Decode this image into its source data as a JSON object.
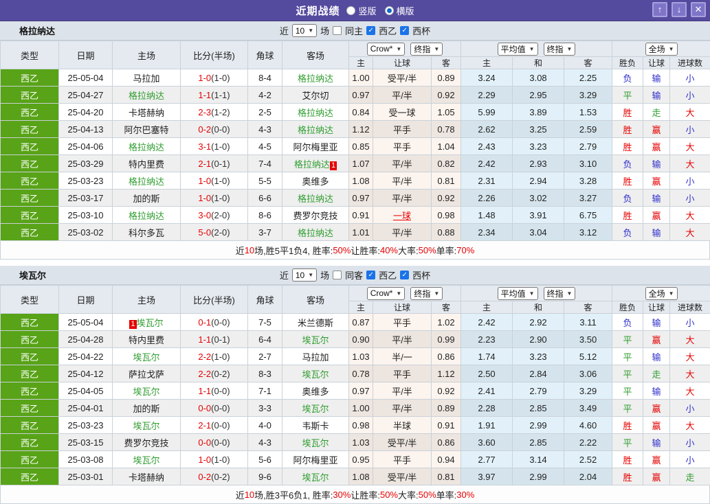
{
  "titlebar": {
    "title": "近期战绩",
    "radios": [
      {
        "label": "竖版",
        "selected": false
      },
      {
        "label": "横版",
        "selected": true
      }
    ],
    "buttons": {
      "up": "↑",
      "down": "↓",
      "close": "✕"
    }
  },
  "controls": {
    "near_label": "近",
    "count": "10",
    "games_label": "场",
    "league1": "西乙",
    "league2": "西杯",
    "odds_source": "Crow*",
    "final_odds": "终指",
    "average": "平均值",
    "scope": "全场"
  },
  "header": {
    "type": "类型",
    "date": "日期",
    "home": "主场",
    "score": "比分(半场)",
    "corner": "角球",
    "away": "客场",
    "sub": {
      "home": "主",
      "handicap": "让球",
      "away": "客",
      "avg_home": "主",
      "avg_draw": "和",
      "avg_away": "客",
      "wdl": "胜负",
      "hcp_result": "让球",
      "goals": "进球数"
    }
  },
  "colors": {
    "accent_purple": "#544a9e",
    "type_green": "#58a317",
    "self_team_green": "#2f9d2f",
    "win_red": "#e60000",
    "lose_blue": "#3030cc",
    "draw_green": "#2f9d2f"
  },
  "sections": [
    {
      "team": "格拉纳达",
      "filter": {
        "same_label": "同主",
        "same_checked": false,
        "league1_checked": true,
        "league2_checked": true
      },
      "rows": [
        {
          "league": "西乙",
          "date": "25-05-04",
          "home": {
            "name": "马拉加",
            "self": false
          },
          "score": "1-0",
          "half": "(1-0)",
          "corner": "8-4",
          "away": {
            "name": "格拉纳达",
            "self": true
          },
          "odds": [
            "1.00",
            "受平/半",
            "0.89"
          ],
          "avg": [
            "3.24",
            "3.08",
            "2.25"
          ],
          "results": [
            "负",
            "输",
            "小"
          ]
        },
        {
          "league": "西乙",
          "date": "25-04-27",
          "home": {
            "name": "格拉纳达",
            "self": true
          },
          "score": "1-1",
          "half": "(1-1)",
          "corner": "4-2",
          "away": {
            "name": "艾尔切",
            "self": false
          },
          "odds": [
            "0.97",
            "平/半",
            "0.92"
          ],
          "avg": [
            "2.29",
            "2.95",
            "3.29"
          ],
          "results": [
            "平",
            "输",
            "小"
          ]
        },
        {
          "league": "西乙",
          "date": "25-04-20",
          "home": {
            "name": "卡塔赫纳",
            "self": false
          },
          "score": "2-3",
          "half": "(1-2)",
          "corner": "2-5",
          "away": {
            "name": "格拉纳达",
            "self": true
          },
          "odds": [
            "0.84",
            "受一球",
            "1.05"
          ],
          "avg": [
            "5.99",
            "3.89",
            "1.53"
          ],
          "results": [
            "胜",
            "走",
            "大"
          ]
        },
        {
          "league": "西乙",
          "date": "25-04-13",
          "home": {
            "name": "阿尔巴塞特",
            "self": false
          },
          "score": "0-2",
          "half": "(0-0)",
          "corner": "4-3",
          "away": {
            "name": "格拉纳达",
            "self": true
          },
          "odds": [
            "1.12",
            "平手",
            "0.78"
          ],
          "avg": [
            "2.62",
            "3.25",
            "2.59"
          ],
          "results": [
            "胜",
            "赢",
            "小"
          ]
        },
        {
          "league": "西乙",
          "date": "25-04-06",
          "home": {
            "name": "格拉纳达",
            "self": true
          },
          "score": "3-1",
          "half": "(1-0)",
          "corner": "4-5",
          "away": {
            "name": "阿尔梅里亚",
            "self": false
          },
          "odds": [
            "0.85",
            "平手",
            "1.04"
          ],
          "avg": [
            "2.43",
            "3.23",
            "2.79"
          ],
          "results": [
            "胜",
            "赢",
            "大"
          ]
        },
        {
          "league": "西乙",
          "date": "25-03-29",
          "home": {
            "name": "特内里费",
            "self": false
          },
          "score": "2-1",
          "half": "(0-1)",
          "corner": "7-4",
          "away": {
            "name": "格拉纳达",
            "self": true,
            "badge": "1",
            "badge_pos": "after"
          },
          "odds": [
            "1.07",
            "平/半",
            "0.82"
          ],
          "avg": [
            "2.42",
            "2.93",
            "3.10"
          ],
          "results": [
            "负",
            "输",
            "大"
          ]
        },
        {
          "league": "西乙",
          "date": "25-03-23",
          "home": {
            "name": "格拉纳达",
            "self": true
          },
          "score": "1-0",
          "half": "(1-0)",
          "corner": "5-5",
          "away": {
            "name": "奥维多",
            "self": false
          },
          "odds": [
            "1.08",
            "平/半",
            "0.81"
          ],
          "avg": [
            "2.31",
            "2.94",
            "3.28"
          ],
          "results": [
            "胜",
            "赢",
            "小"
          ]
        },
        {
          "league": "西乙",
          "date": "25-03-17",
          "home": {
            "name": "加的斯",
            "self": false
          },
          "score": "1-0",
          "half": "(1-0)",
          "corner": "6-6",
          "away": {
            "name": "格拉纳达",
            "self": true
          },
          "odds": [
            "0.97",
            "平/半",
            "0.92"
          ],
          "avg": [
            "2.26",
            "3.02",
            "3.27"
          ],
          "results": [
            "负",
            "输",
            "小"
          ]
        },
        {
          "league": "西乙",
          "date": "25-03-10",
          "home": {
            "name": "格拉纳达",
            "self": true
          },
          "score": "3-0",
          "half": "(2-0)",
          "corner": "8-6",
          "away": {
            "name": "费罗尔竞技",
            "self": false
          },
          "odds": [
            "0.91",
            "一球",
            "0.98"
          ],
          "hcp_red": true,
          "avg": [
            "1.48",
            "3.91",
            "6.75"
          ],
          "results": [
            "胜",
            "赢",
            "大"
          ]
        },
        {
          "league": "西乙",
          "date": "25-03-02",
          "home": {
            "name": "科尔多瓦",
            "self": false
          },
          "score": "5-0",
          "half": "(2-0)",
          "corner": "3-7",
          "away": {
            "name": "格拉纳达",
            "self": true
          },
          "odds": [
            "1.01",
            "平/半",
            "0.88"
          ],
          "avg": [
            "2.34",
            "3.04",
            "3.12"
          ],
          "results": [
            "负",
            "输",
            "大"
          ]
        }
      ],
      "summary_parts": [
        {
          "t": "近"
        },
        {
          "t": "10",
          "red": true
        },
        {
          "t": "场,胜5平1负4, 胜率:"
        },
        {
          "t": "50%",
          "red": true
        },
        {
          "t": " 让胜率:"
        },
        {
          "t": "40%",
          "red": true
        },
        {
          "t": " 大率:"
        },
        {
          "t": "50%",
          "red": true
        },
        {
          "t": " 单率:"
        },
        {
          "t": "70%",
          "red": true
        }
      ]
    },
    {
      "team": "埃瓦尔",
      "filter": {
        "same_label": "同客",
        "same_checked": false,
        "league1_checked": true,
        "league2_checked": true
      },
      "rows": [
        {
          "league": "西乙",
          "date": "25-05-04",
          "home": {
            "name": "埃瓦尔",
            "self": true,
            "badge": "1",
            "badge_pos": "before"
          },
          "score": "0-1",
          "half": "(0-0)",
          "corner": "7-5",
          "away": {
            "name": "米兰德斯",
            "self": false
          },
          "odds": [
            "0.87",
            "平手",
            "1.02"
          ],
          "avg": [
            "2.42",
            "2.92",
            "3.11"
          ],
          "results": [
            "负",
            "输",
            "小"
          ]
        },
        {
          "league": "西乙",
          "date": "25-04-28",
          "home": {
            "name": "特内里费",
            "self": false
          },
          "score": "1-1",
          "half": "(0-1)",
          "corner": "6-4",
          "away": {
            "name": "埃瓦尔",
            "self": true
          },
          "odds": [
            "0.90",
            "平/半",
            "0.99"
          ],
          "avg": [
            "2.23",
            "2.90",
            "3.50"
          ],
          "results": [
            "平",
            "赢",
            "大"
          ]
        },
        {
          "league": "西乙",
          "date": "25-04-22",
          "home": {
            "name": "埃瓦尔",
            "self": true
          },
          "score": "2-2",
          "half": "(1-0)",
          "corner": "2-7",
          "away": {
            "name": "马拉加",
            "self": false
          },
          "odds": [
            "1.03",
            "半/一",
            "0.86"
          ],
          "avg": [
            "1.74",
            "3.23",
            "5.12"
          ],
          "results": [
            "平",
            "输",
            "大"
          ]
        },
        {
          "league": "西乙",
          "date": "25-04-12",
          "home": {
            "name": "萨拉戈萨",
            "self": false
          },
          "score": "2-2",
          "half": "(0-2)",
          "corner": "8-3",
          "away": {
            "name": "埃瓦尔",
            "self": true
          },
          "odds": [
            "0.78",
            "平手",
            "1.12"
          ],
          "avg": [
            "2.50",
            "2.84",
            "3.06"
          ],
          "results": [
            "平",
            "走",
            "大"
          ]
        },
        {
          "league": "西乙",
          "date": "25-04-05",
          "home": {
            "name": "埃瓦尔",
            "self": true
          },
          "score": "1-1",
          "half": "(0-0)",
          "corner": "7-1",
          "away": {
            "name": "奥维多",
            "self": false
          },
          "odds": [
            "0.97",
            "平/半",
            "0.92"
          ],
          "avg": [
            "2.41",
            "2.79",
            "3.29"
          ],
          "results": [
            "平",
            "输",
            "大"
          ]
        },
        {
          "league": "西乙",
          "date": "25-04-01",
          "home": {
            "name": "加的斯",
            "self": false
          },
          "score": "0-0",
          "half": "(0-0)",
          "corner": "3-3",
          "away": {
            "name": "埃瓦尔",
            "self": true
          },
          "odds": [
            "1.00",
            "平/半",
            "0.89"
          ],
          "avg": [
            "2.28",
            "2.85",
            "3.49"
          ],
          "results": [
            "平",
            "赢",
            "小"
          ]
        },
        {
          "league": "西乙",
          "date": "25-03-23",
          "home": {
            "name": "埃瓦尔",
            "self": true
          },
          "score": "2-1",
          "half": "(0-0)",
          "corner": "4-0",
          "away": {
            "name": "韦斯卡",
            "self": false
          },
          "odds": [
            "0.98",
            "半球",
            "0.91"
          ],
          "avg": [
            "1.91",
            "2.99",
            "4.60"
          ],
          "results": [
            "胜",
            "赢",
            "大"
          ]
        },
        {
          "league": "西乙",
          "date": "25-03-15",
          "home": {
            "name": "费罗尔竞技",
            "self": false
          },
          "score": "0-0",
          "half": "(0-0)",
          "corner": "4-3",
          "away": {
            "name": "埃瓦尔",
            "self": true
          },
          "odds": [
            "1.03",
            "受平/半",
            "0.86"
          ],
          "avg": [
            "3.60",
            "2.85",
            "2.22"
          ],
          "results": [
            "平",
            "输",
            "小"
          ]
        },
        {
          "league": "西乙",
          "date": "25-03-08",
          "home": {
            "name": "埃瓦尔",
            "self": true
          },
          "score": "1-0",
          "half": "(1-0)",
          "corner": "5-6",
          "away": {
            "name": "阿尔梅里亚",
            "self": false
          },
          "odds": [
            "0.95",
            "平手",
            "0.94"
          ],
          "avg": [
            "2.77",
            "3.14",
            "2.52"
          ],
          "results": [
            "胜",
            "赢",
            "小"
          ]
        },
        {
          "league": "西乙",
          "date": "25-03-01",
          "home": {
            "name": "卡塔赫纳",
            "self": false
          },
          "score": "0-2",
          "half": "(0-2)",
          "corner": "9-6",
          "away": {
            "name": "埃瓦尔",
            "self": true
          },
          "odds": [
            "1.08",
            "受平/半",
            "0.81"
          ],
          "avg": [
            "3.97",
            "2.99",
            "2.04"
          ],
          "results": [
            "胜",
            "赢",
            "走"
          ]
        }
      ],
      "summary_parts": [
        {
          "t": "近"
        },
        {
          "t": "10",
          "red": true
        },
        {
          "t": "场,胜3平6负1, 胜率:"
        },
        {
          "t": "30%",
          "red": true
        },
        {
          "t": " 让胜率:"
        },
        {
          "t": "50%",
          "red": true
        },
        {
          "t": " 大率:"
        },
        {
          "t": "50%",
          "red": true
        },
        {
          "t": " 单率:"
        },
        {
          "t": "30%",
          "red": true
        }
      ]
    }
  ]
}
